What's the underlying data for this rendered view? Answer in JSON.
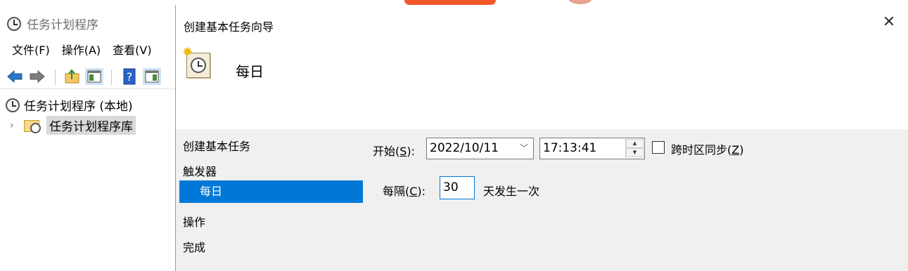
{
  "background_window": {
    "title": "任务计划程序",
    "menu": [
      "文件(F)",
      "操作(A)",
      "查看(V)"
    ],
    "tree": {
      "root": "任务计划程序 (本地)",
      "child": "任务计划程序库"
    }
  },
  "dialog": {
    "title": "创建基本任务向导",
    "heading": "每日",
    "steps": [
      "创建基本任务",
      "触发器",
      "每日",
      "操作",
      "完成"
    ],
    "selected_step": "每日",
    "start": {
      "label_prefix": "开始(",
      "mnemonic": "S",
      "label_suffix": "):",
      "date": "2022/10/11",
      "time": "17:13:41"
    },
    "sync": {
      "label_prefix": "跨时区同步(",
      "mnemonic": "Z",
      "label_suffix": ")",
      "checked": false
    },
    "recur": {
      "label_prefix": "每隔(",
      "mnemonic": "C",
      "label_suffix": "):",
      "value": "30",
      "suffix": "天发生一次"
    }
  },
  "colors": {
    "selection": "#0078d7",
    "dialog_body": "#f0f0f0"
  }
}
